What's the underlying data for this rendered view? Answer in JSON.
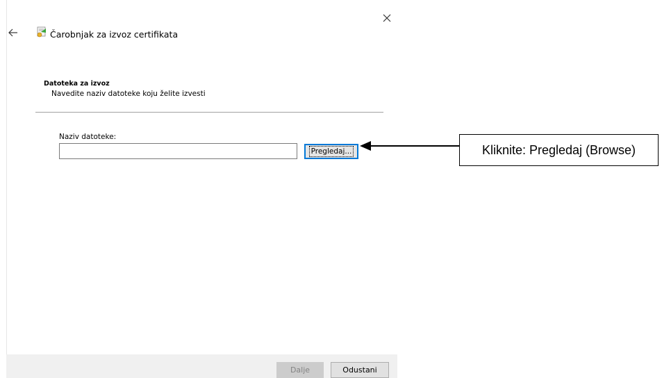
{
  "window": {
    "title": "Čarobnjak za izvoz certifikata",
    "close_icon": "close-icon",
    "back_icon": "back-arrow-icon",
    "app_icon": "certificate-icon"
  },
  "page": {
    "heading": "Datoteka za izvoz",
    "subheading": "Navedite naziv datoteke koju želite izvesti"
  },
  "form": {
    "filename_label": "Naziv datoteke:",
    "filename_value": "",
    "browse_label": "Pregledaj..."
  },
  "footer": {
    "next_label": "Dalje",
    "next_enabled": false,
    "cancel_label": "Odustani"
  },
  "annotation": {
    "callout_text": "Kliknite: Pregledaj (Browse)"
  },
  "colors": {
    "focus_border": "#0078d7",
    "footer_bg": "#f0f0f0",
    "divider": "#a0a0a0"
  }
}
